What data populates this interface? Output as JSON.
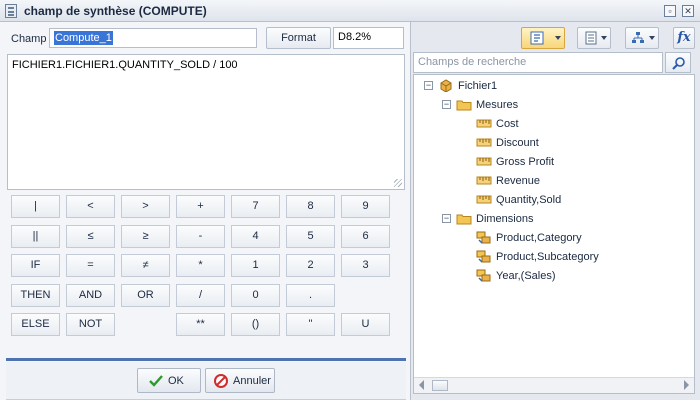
{
  "window": {
    "title": "champ de synthèse (COMPUTE)",
    "restore_glyph": "▫",
    "close_glyph": "✕"
  },
  "field": {
    "name_label": "Champ",
    "name_value": "Compute_1",
    "format_button": "Format",
    "format_value": "D8.2%"
  },
  "expression": "FICHIER1.FICHIER1.QUANTITY_SOLD / 100",
  "keypad": [
    [
      "|",
      "<",
      ">",
      "+",
      "7",
      "8",
      "9"
    ],
    [
      "||",
      "≤",
      "≥",
      "-",
      "4",
      "5",
      "6"
    ],
    [
      "IF",
      "=",
      "≠",
      "*",
      "1",
      "2",
      "3"
    ],
    [
      "THEN",
      "AND",
      "OR",
      "/",
      "0",
      ".",
      ""
    ],
    [
      "ELSE",
      "NOT",
      "",
      "**",
      "()",
      "\"",
      "U"
    ]
  ],
  "footer": {
    "ok_label": "OK",
    "cancel_label": "Annuler"
  },
  "right_panel": {
    "search_placeholder": "Champs de recherche",
    "fx_label": "fx",
    "tree": {
      "root": "Fichier1",
      "groups": [
        {
          "label": "Mesures",
          "items": [
            "Cost",
            "Discount",
            "Gross Profit",
            "Revenue",
            "Quantity,Sold"
          ]
        },
        {
          "label": "Dimensions",
          "items": [
            "Product,Category",
            "Product,Subcategory",
            "Year,(Sales)"
          ]
        }
      ]
    }
  },
  "colors": {
    "accent_blue": "#4d73b0",
    "selection": "#3875d7",
    "active_tool": "#f8d67a"
  }
}
